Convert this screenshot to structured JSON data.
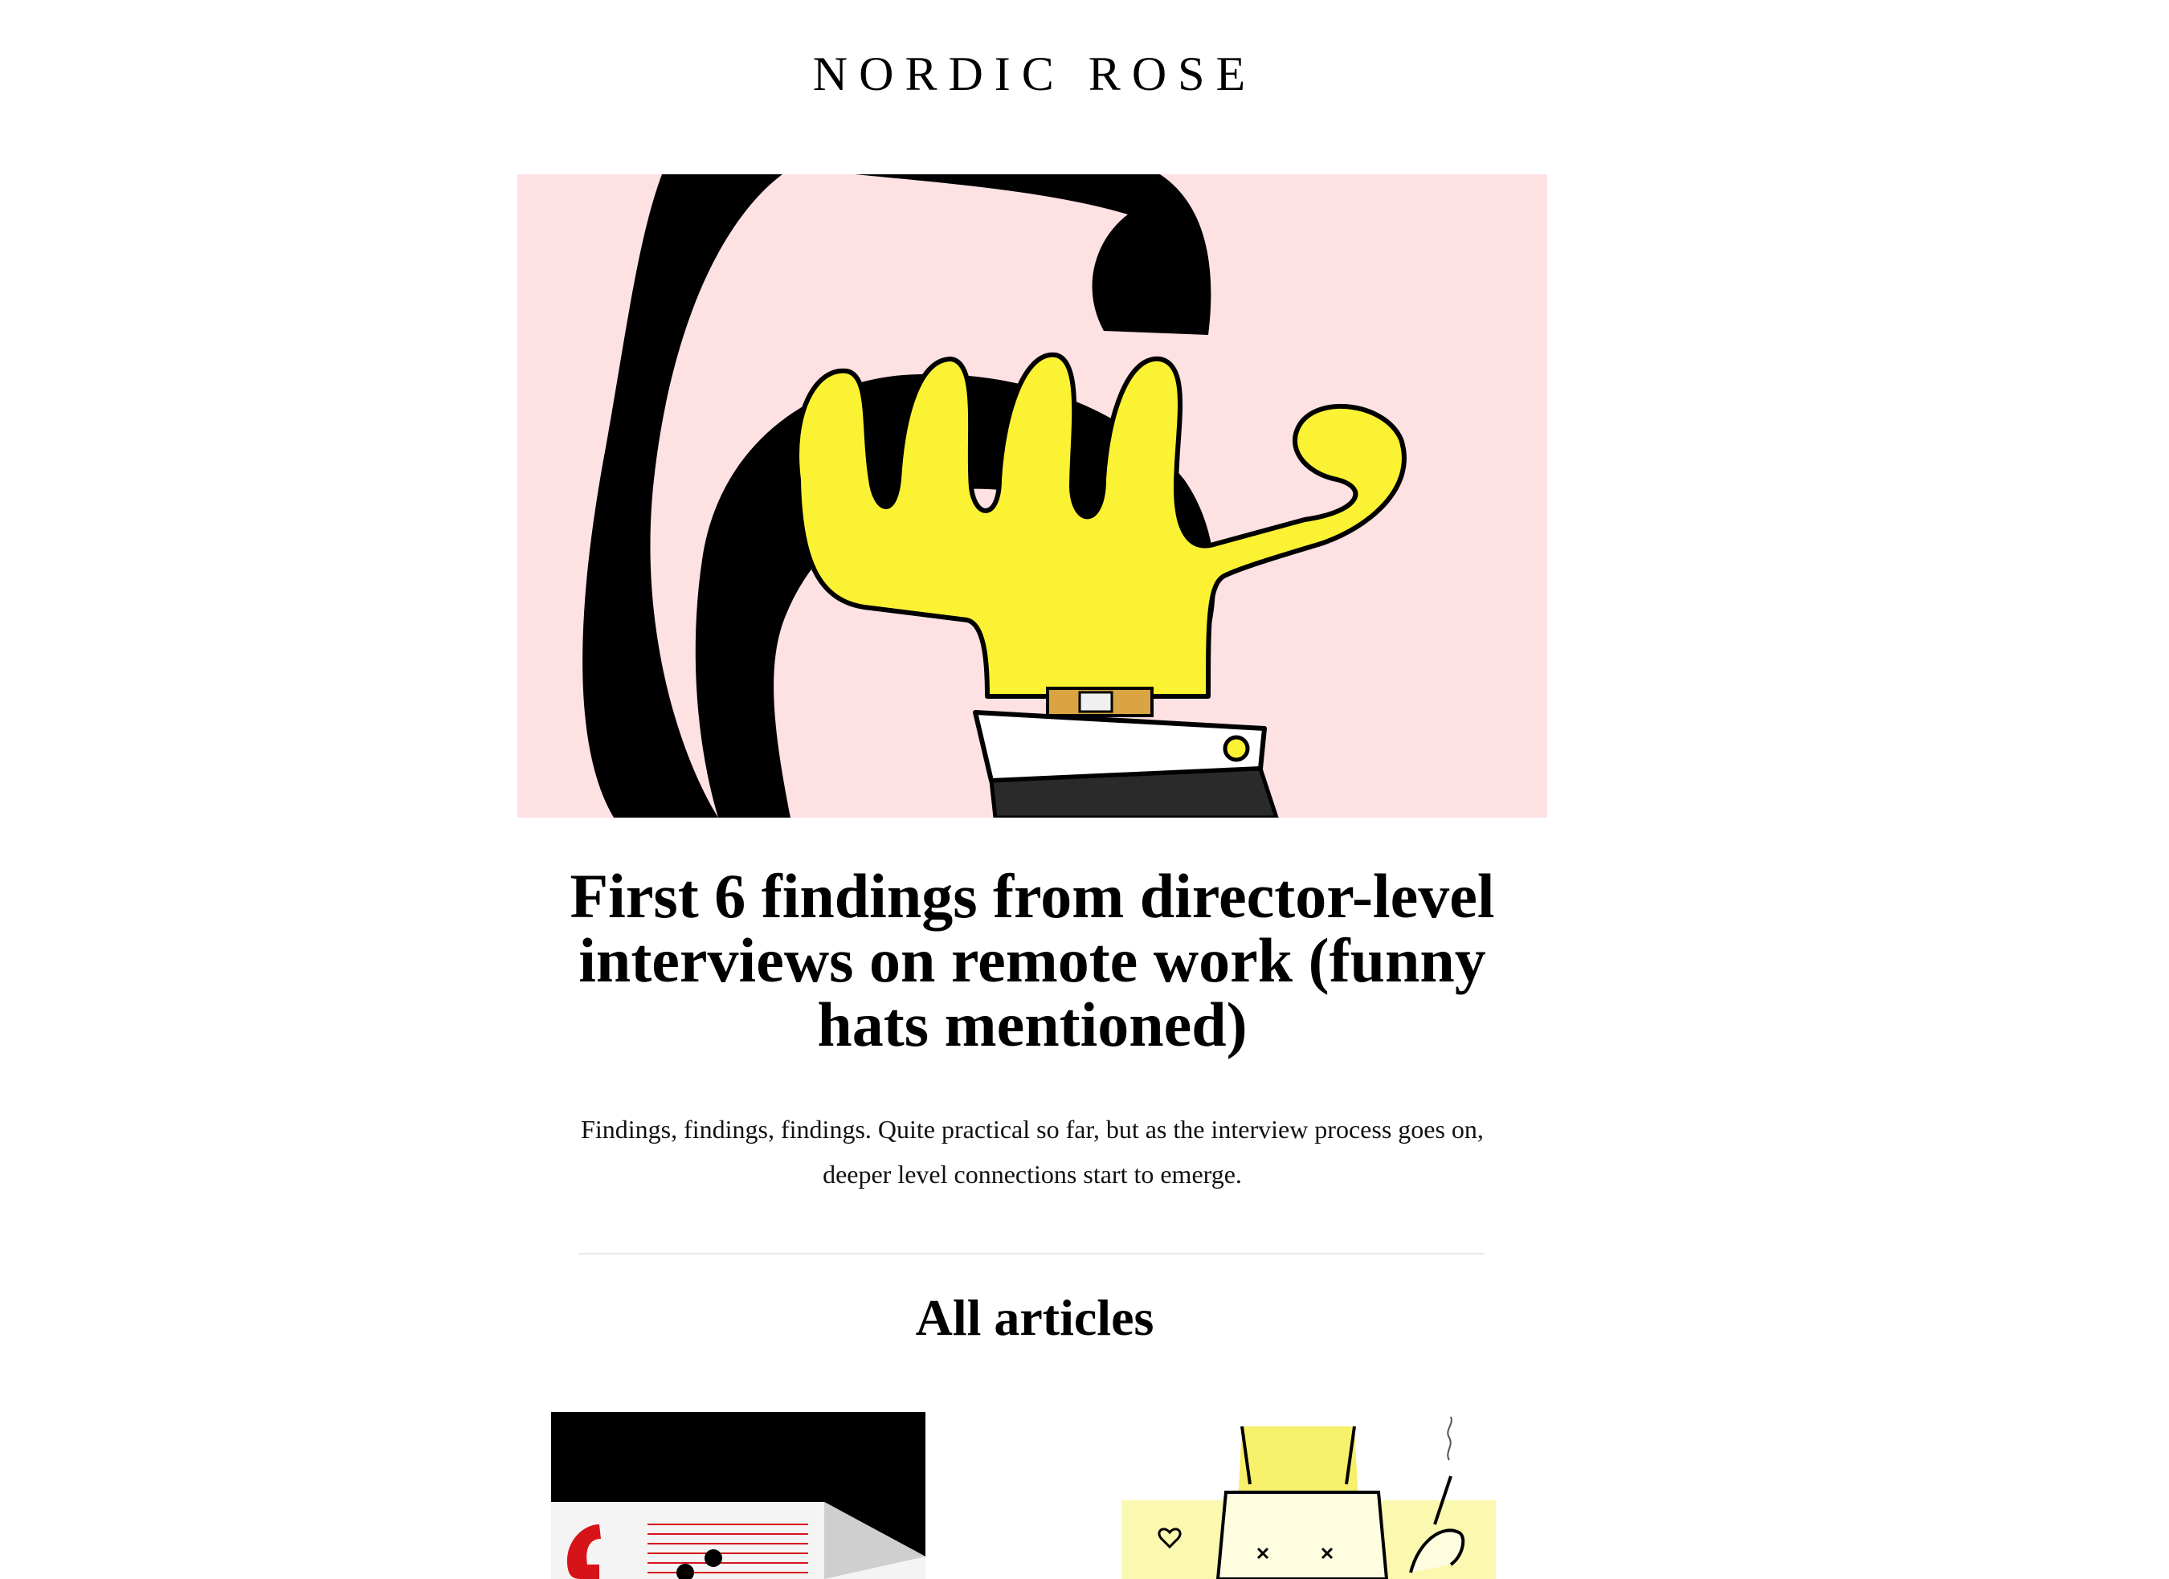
{
  "site": {
    "title": "NORDIC ROSE"
  },
  "featured": {
    "title": "First 6 findings from director-level interviews on remote work (funny hats mentioned)",
    "summary": "Findings, findings, findings. Quite practical so far, but as the interview process goes on, deeper level connections start to emerge.",
    "image_description_icon": "hand-watch-illustration",
    "colors": {
      "hero_bg": "#fde1e3",
      "hand": "#fcf234"
    }
  },
  "articles": {
    "heading": "All articles"
  }
}
